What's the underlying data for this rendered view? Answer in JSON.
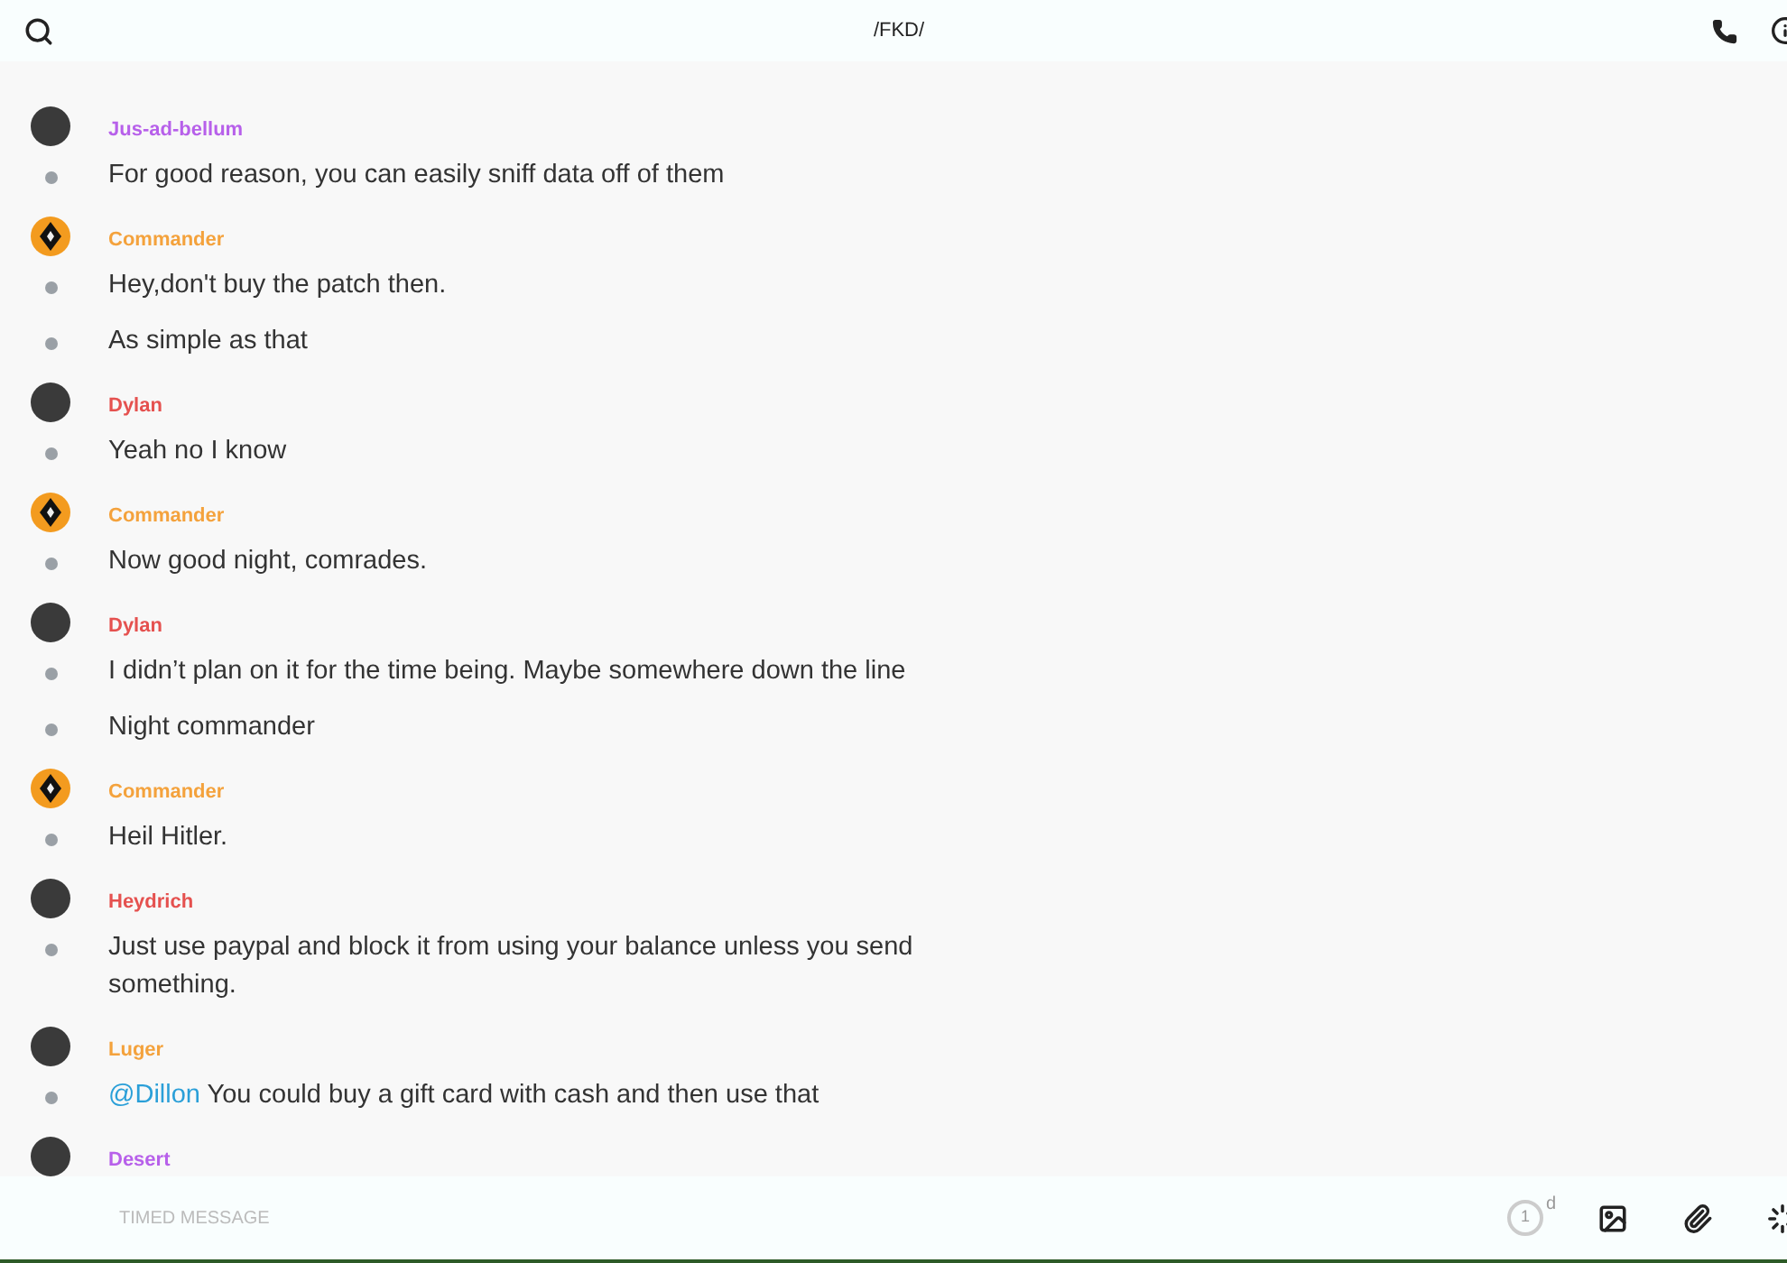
{
  "header": {
    "title": "/FKD/"
  },
  "groups": [
    {
      "author": "Jus-ad-bellum",
      "color": "#b760ea",
      "kind": "photo",
      "messages": [
        {
          "text": "For good reason, you can easily sniff data off of them"
        }
      ]
    },
    {
      "author": "Commander",
      "color": "#f4a23c",
      "kind": "emblem",
      "messages": [
        {
          "text": "Hey,don't buy the patch then."
        },
        {
          "text": "As simple as that"
        }
      ]
    },
    {
      "author": "Dylan",
      "color": "#e5514f",
      "kind": "photo",
      "messages": [
        {
          "text": "Yeah no I know"
        }
      ]
    },
    {
      "author": "Commander",
      "color": "#f4a23c",
      "kind": "emblem",
      "messages": [
        {
          "text": "Now good night, comrades."
        }
      ]
    },
    {
      "author": "Dylan",
      "color": "#e5514f",
      "kind": "photo",
      "messages": [
        {
          "text": "I didn’t plan on it for the time being. Maybe somewhere down the line"
        },
        {
          "text": "Night commander"
        }
      ]
    },
    {
      "author": "Commander",
      "color": "#f4a23c",
      "kind": "emblem",
      "messages": [
        {
          "text": "Heil Hitler."
        }
      ]
    },
    {
      "author": "Heydrich",
      "color": "#e5514f",
      "kind": "photo",
      "messages": [
        {
          "text": "Just use paypal and block it from using your balance unless you send something."
        }
      ]
    },
    {
      "author": "Luger",
      "color": "#f4a23c",
      "kind": "photo",
      "messages": [
        {
          "mention": "@Dillon",
          "text": "You could buy a gift card with cash and then use that"
        }
      ]
    },
    {
      "author": "Desert",
      "color": "#b760ea",
      "kind": "photo"
    }
  ],
  "composer": {
    "placeholder": "TIMED MESSAGE",
    "timer": {
      "value": "1",
      "unit": "d"
    }
  }
}
